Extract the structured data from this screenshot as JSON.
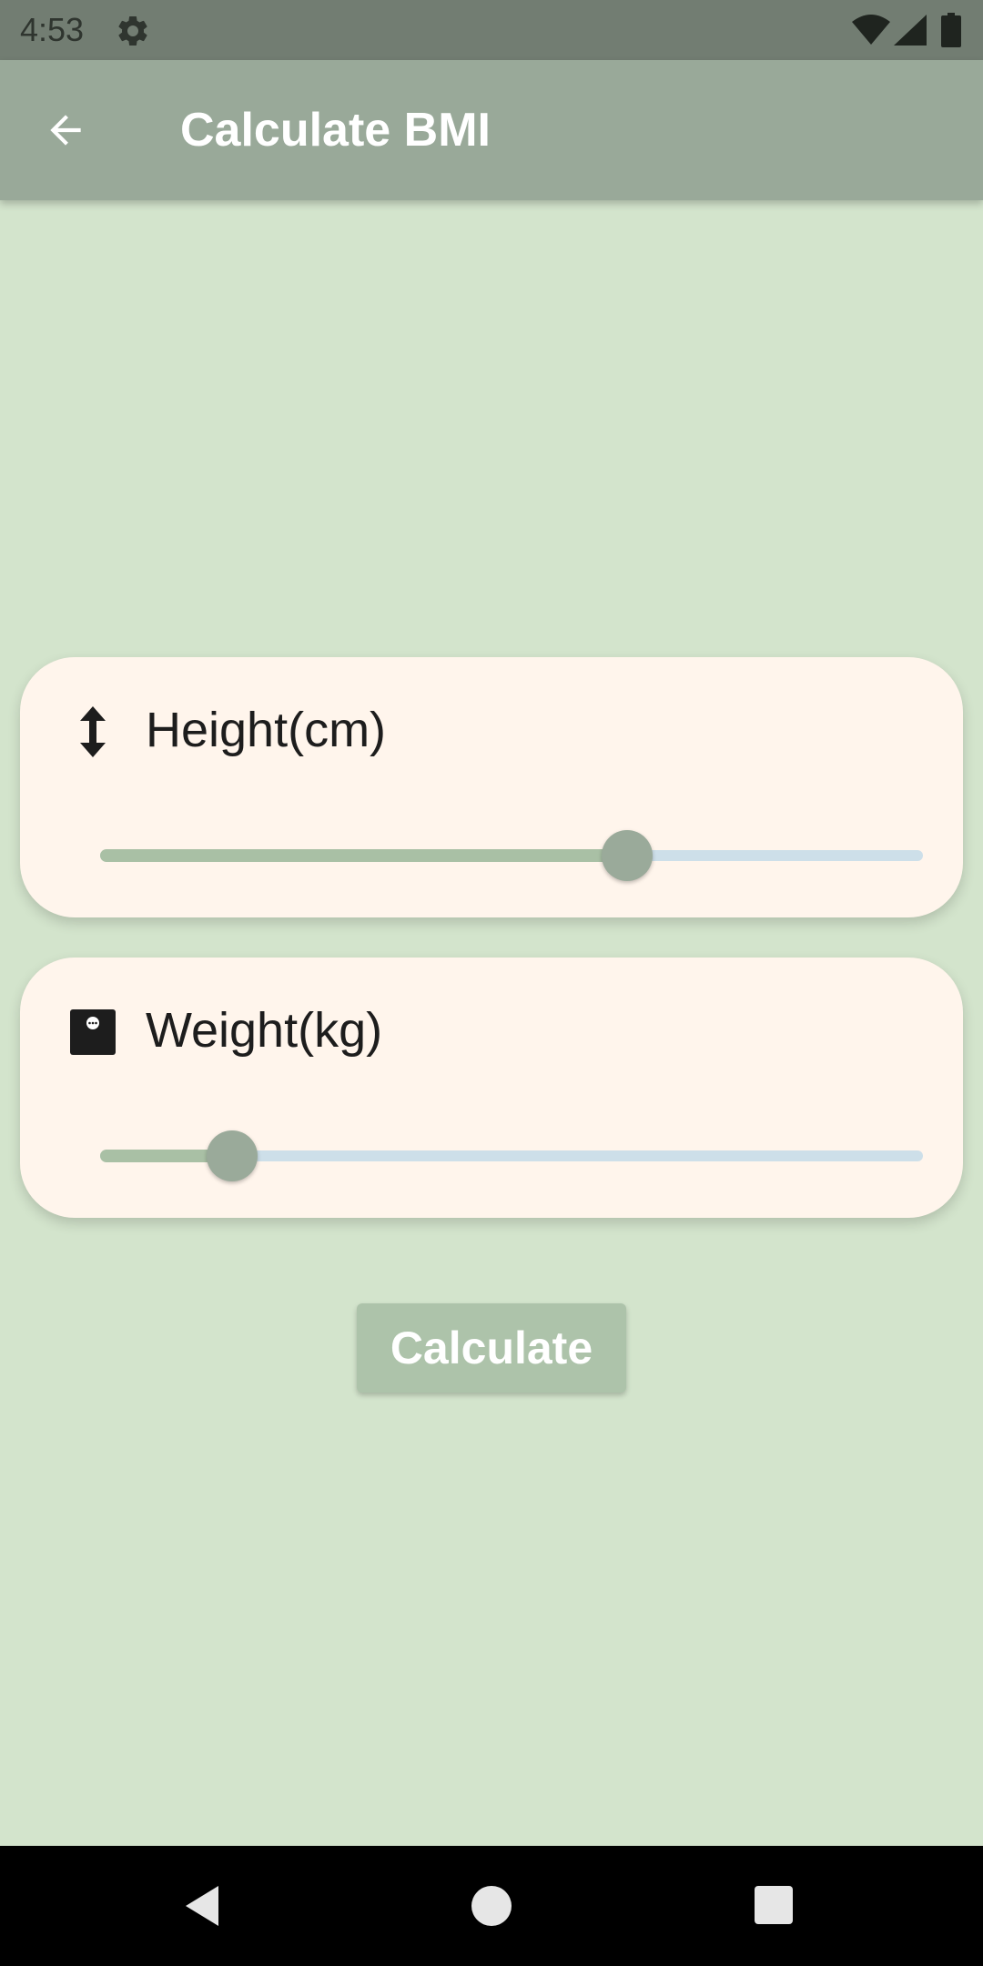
{
  "status_bar": {
    "time": "4:53",
    "icons": [
      "gear-icon",
      "wifi-icon",
      "signal-icon",
      "battery-icon"
    ]
  },
  "app_bar": {
    "back_icon": "arrow-back-icon",
    "title": "Calculate BMI"
  },
  "height_card": {
    "icon": "height-arrows-icon",
    "label": "Height(cm)",
    "slider_fraction": 0.64
  },
  "weight_card": {
    "icon": "scale-icon",
    "label": "Weight(kg)",
    "slider_fraction": 0.16
  },
  "calculate_button": {
    "label": "Calculate"
  },
  "nav_bar": {
    "icons": [
      "nav-back-icon",
      "nav-home-icon",
      "nav-recents-icon"
    ]
  },
  "colors": {
    "background": "#d3e4cc",
    "app_bar": "#99a999",
    "card": "#fff5ec",
    "slider_active": "#a9c0a5",
    "slider_inactive": "#cddfe9",
    "slider_thumb": "#9aaa9a",
    "button": "#adc3aa"
  }
}
